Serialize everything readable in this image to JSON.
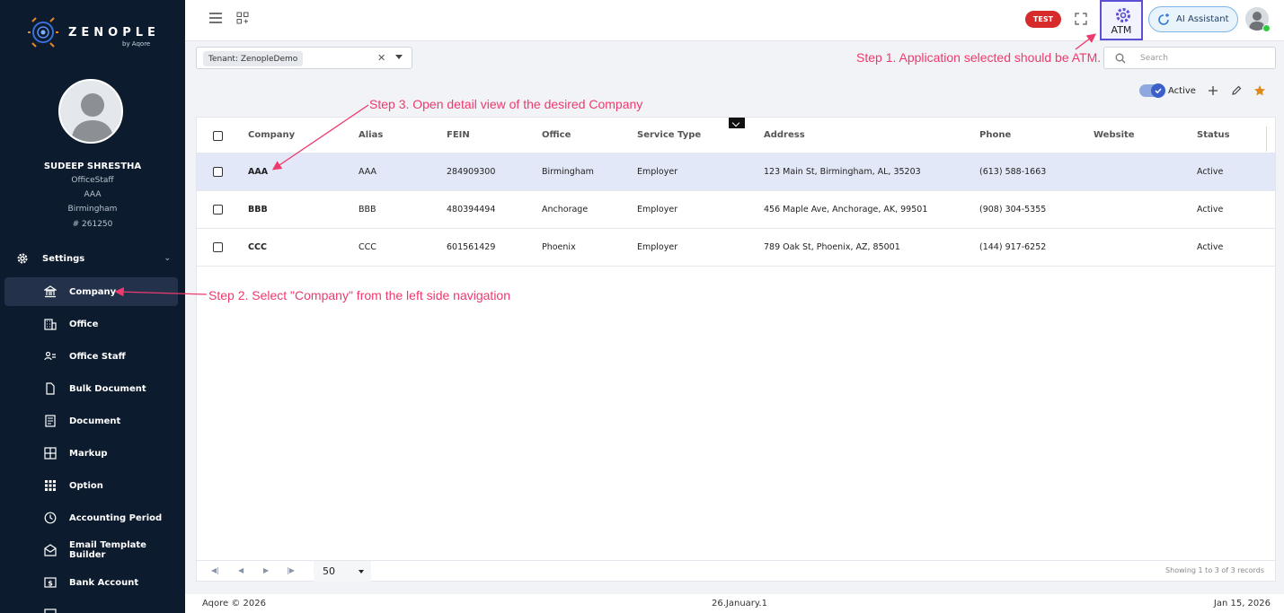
{
  "app": {
    "brand": "ZENOPLE",
    "brand_sub": "by Aqore"
  },
  "user": {
    "name": "SUDEEP SHRESTHA",
    "role": "OfficeStaff",
    "company": "AAA",
    "office": "Birmingham",
    "id": "# 261250"
  },
  "sidebar": {
    "section": "Settings",
    "items": [
      {
        "label": "Company",
        "icon": "bank-icon"
      },
      {
        "label": "Office",
        "icon": "building-icon"
      },
      {
        "label": "Office Staff",
        "icon": "users-icon"
      },
      {
        "label": "Bulk Document",
        "icon": "file-icon"
      },
      {
        "label": "Document",
        "icon": "document-icon"
      },
      {
        "label": "Markup",
        "icon": "grid-icon"
      },
      {
        "label": "Option",
        "icon": "dots-grid-icon"
      },
      {
        "label": "Accounting Period",
        "icon": "clock-icon"
      },
      {
        "label": "Email Template Builder",
        "icon": "envelope-icon"
      },
      {
        "label": "Bank Account",
        "icon": "dollar-icon"
      }
    ]
  },
  "topbar": {
    "env_badge": "TEST",
    "app_selected": "ATM",
    "ai_assistant": "AI Assistant"
  },
  "filters": {
    "tenant_label": "Tenant:",
    "tenant_value": "ZenopleDemo",
    "search_placeholder": "Search"
  },
  "toolbar": {
    "active_label": "Active"
  },
  "table": {
    "columns": [
      "Company",
      "Alias",
      "FEIN",
      "Office",
      "Service Type",
      "Address",
      "Phone",
      "Website",
      "Status"
    ],
    "rows": [
      [
        "AAA",
        "AAA",
        "284909300",
        "Birmingham",
        "Employer",
        "123 Main St, Birmingham, AL, 35203",
        "(613) 588-1663",
        "",
        "Active"
      ],
      [
        "BBB",
        "BBB",
        "480394494",
        "Anchorage",
        "Employer",
        "456 Maple Ave, Anchorage, AK, 99501",
        "(908) 304-5355",
        "",
        "Active"
      ],
      [
        "CCC",
        "CCC",
        "601561429",
        "Phoenix",
        "Employer",
        "789 Oak St, Phoenix, AZ, 85001",
        "(144) 917-6252",
        "",
        "Active"
      ]
    ]
  },
  "pager": {
    "page_size": "50",
    "info": "Showing 1 to 3 of 3 records"
  },
  "footer": {
    "copyright": "Aqore © 2026",
    "version": "26.January.1",
    "date": "Jan 15, 2026"
  },
  "annotations": {
    "step1": "Step 1. Application selected should be ATM.",
    "step2": "Step 2. Select \"Company\" from the left side navigation",
    "step3": "Step 3. Open detail view of the desired Company"
  },
  "colors": {
    "sidebar_bg": "#0d1b2e",
    "annotation": "#ee3a6d",
    "badge_red": "#d72b2b",
    "selected_row": "#e3e8f8",
    "accent_purple": "#5b4fd6"
  }
}
